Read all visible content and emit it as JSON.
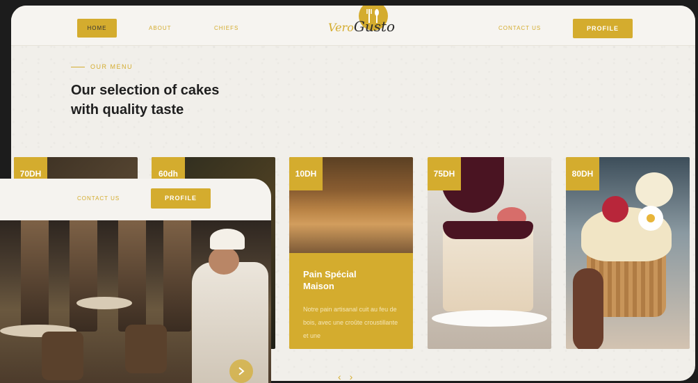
{
  "nav": {
    "home": "HOME",
    "about": "ABOUT",
    "chiefs": "CHIEFS",
    "contact": "CONTACT US",
    "profile": "PROFILE",
    "logo_part1": "Vero",
    "logo_part2": "Gusto"
  },
  "menu": {
    "kicker": "OUR MENU",
    "headline_line1": "Our selection of cakes",
    "headline_line2": "with quality taste"
  },
  "cards": [
    {
      "price": "70DH"
    },
    {
      "price": "60dh"
    },
    {
      "price": "10DH",
      "title": "Pain Spécial Maison",
      "desc": "Notre pain artisanal cuit au feu de bois, avec une croûte croustillante et une"
    },
    {
      "price": "75DH"
    },
    {
      "price": "80DH"
    }
  ],
  "carousel": {
    "prev": "‹",
    "next": "›"
  },
  "overlay": {
    "contact": "CONTACT US",
    "profile": "PROFILE"
  },
  "colors": {
    "accent": "#d4ac2e",
    "background": "#f1efea",
    "text": "#1f1f1f"
  }
}
